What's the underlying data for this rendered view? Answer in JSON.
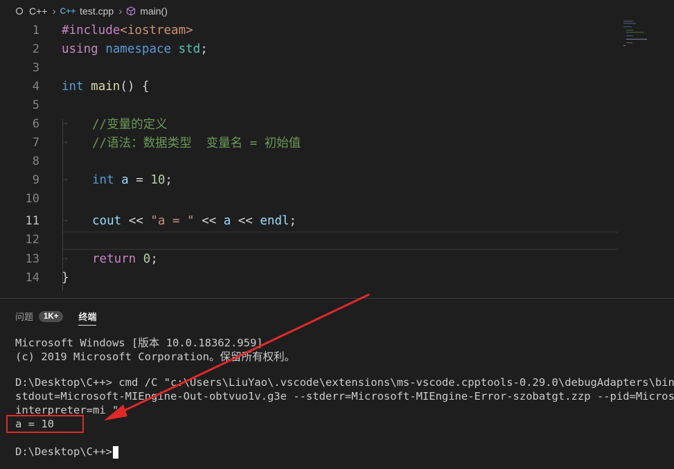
{
  "breadcrumb": {
    "folder": "C++",
    "file_icon": "C++",
    "file": "test.cpp",
    "symbol": "main()"
  },
  "editor": {
    "line_numbers": [
      "1",
      "2",
      "3",
      "4",
      "5",
      "6",
      "7",
      "8",
      "9",
      "10",
      "11",
      "12",
      "13",
      "14"
    ],
    "lines": {
      "l1_pre": "#include",
      "l1_inc": "<iostream>",
      "l2_using": "using",
      "l2_ns": "namespace",
      "l2_std": "std",
      "l2_semi": ";",
      "l4_int": "int",
      "l4_main": "main",
      "l4_rest": "() {",
      "l6_cmt": "//变量的定义",
      "l7_cmt": "//语法：数据类型  变量名 = 初始值",
      "l9_int": "int",
      "l9_a": "a",
      "l9_eq": " = ",
      "l9_num": "10",
      "l9_semi": ";",
      "l11_cout": "cout",
      "l11_op1": " << ",
      "l11_str": "\"a = \"",
      "l11_op2": " << ",
      "l11_a": "a",
      "l11_op3": " << ",
      "l11_endl": "endl",
      "l11_semi": ";",
      "l13_ret": "return",
      "l13_num": "0",
      "l13_semi": ";",
      "l14_brace": "}"
    }
  },
  "panel": {
    "tabs": {
      "problems": "问题",
      "problems_count": "1K+",
      "terminal": "终端"
    },
    "terminal_lines": [
      "Microsoft Windows [版本 10.0.18362.959]",
      "(c) 2019 Microsoft Corporation。保留所有权利。",
      "",
      "D:\\Desktop\\C++> cmd /C \"c:\\Users\\LiuYao\\.vscode\\extensions\\ms-vscode.cpptools-0.29.0\\debugAdapters\\bin\\Win",
      "stdout=Microsoft-MIEngine-Out-obtvuo1v.g3e --stderr=Microsoft-MIEngine-Error-szobatgt.zzp --pid=Microsoft-",
      "interpreter=mi \"",
      "a = 10",
      "",
      "D:\\Desktop\\C++>"
    ]
  },
  "colors": {
    "background": "#1e1e1e",
    "annotation_red": "#e02a2a",
    "keyword": "#569cd6",
    "comment": "#6a9955",
    "string": "#ce9178"
  }
}
